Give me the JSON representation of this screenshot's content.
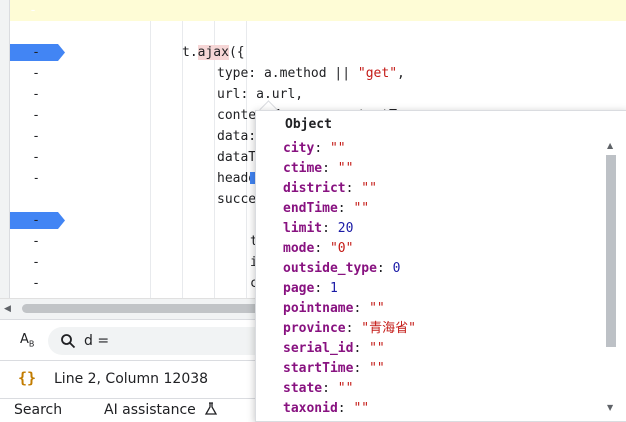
{
  "editor": {
    "lines": [
      {
        "mark": "-",
        "breakpoint": true,
        "text_before": "t.",
        "ajax": "ajax",
        "text_after": "({",
        "indent": 0,
        "highlight": true
      },
      {
        "mark": "-",
        "breakpoint": false,
        "key": "type: a.method || ",
        "str": "\"get\"",
        "tail": ","
      },
      {
        "mark": "-",
        "breakpoint": false,
        "key": "url: a.url,"
      },
      {
        "mark": "-",
        "breakpoint": false,
        "key": "contentType: a.contentType,"
      },
      {
        "mark": "-",
        "breakpoint": false,
        "key": "data: ",
        "boxed": "d",
        "tail": ","
      },
      {
        "mark": "-",
        "breakpoint": false,
        "key": "dataT"
      },
      {
        "mark": "-",
        "breakpoint": false,
        "key": "heade"
      },
      {
        "mark": "-",
        "breakpoint": false,
        "key": "succe"
      },
      {
        "mark": "-",
        "breakpoint": true,
        "key": ""
      },
      {
        "mark": "-",
        "breakpoint": false,
        "key": "t"
      },
      {
        "mark": "-",
        "breakpoint": false,
        "key": "i"
      },
      {
        "mark": "-",
        "breakpoint": false,
        "key": "c"
      },
      {
        "mark": "-",
        "breakpoint": false,
        "key": "a"
      },
      {
        "mark": "-",
        "breakpoint": false,
        "key": "i"
      }
    ]
  },
  "search": {
    "value": "d =",
    "match_case_icon": "AB"
  },
  "status": {
    "position": "Line 2, Column 12038",
    "format_icon": "{}"
  },
  "tabs": {
    "search": "Search",
    "ai": "AI assistance"
  },
  "popover": {
    "title": "Object",
    "properties": [
      {
        "name": "city",
        "value": "\"\"",
        "kind": "string"
      },
      {
        "name": "ctime",
        "value": "\"\"",
        "kind": "string"
      },
      {
        "name": "district",
        "value": "\"\"",
        "kind": "string"
      },
      {
        "name": "endTime",
        "value": "\"\"",
        "kind": "string"
      },
      {
        "name": "limit",
        "value": "20",
        "kind": "number"
      },
      {
        "name": "mode",
        "value": "\"0\"",
        "kind": "string"
      },
      {
        "name": "outside_type",
        "value": "0",
        "kind": "number"
      },
      {
        "name": "page",
        "value": "1",
        "kind": "number"
      },
      {
        "name": "pointname",
        "value": "\"\"",
        "kind": "string"
      },
      {
        "name": "province",
        "value": "\"青海省\"",
        "kind": "string"
      },
      {
        "name": "serial_id",
        "value": "\"\"",
        "kind": "string"
      },
      {
        "name": "startTime",
        "value": "\"\"",
        "kind": "string"
      },
      {
        "name": "state",
        "value": "\"\"",
        "kind": "string"
      },
      {
        "name": "taxonid",
        "value": "\"\"",
        "kind": "string"
      }
    ]
  },
  "colors": {
    "breakpoint": "#4285f4",
    "string": "#c41a16",
    "number": "#1a1aa6",
    "property": "#881280",
    "current_line": "#fefcd6"
  }
}
